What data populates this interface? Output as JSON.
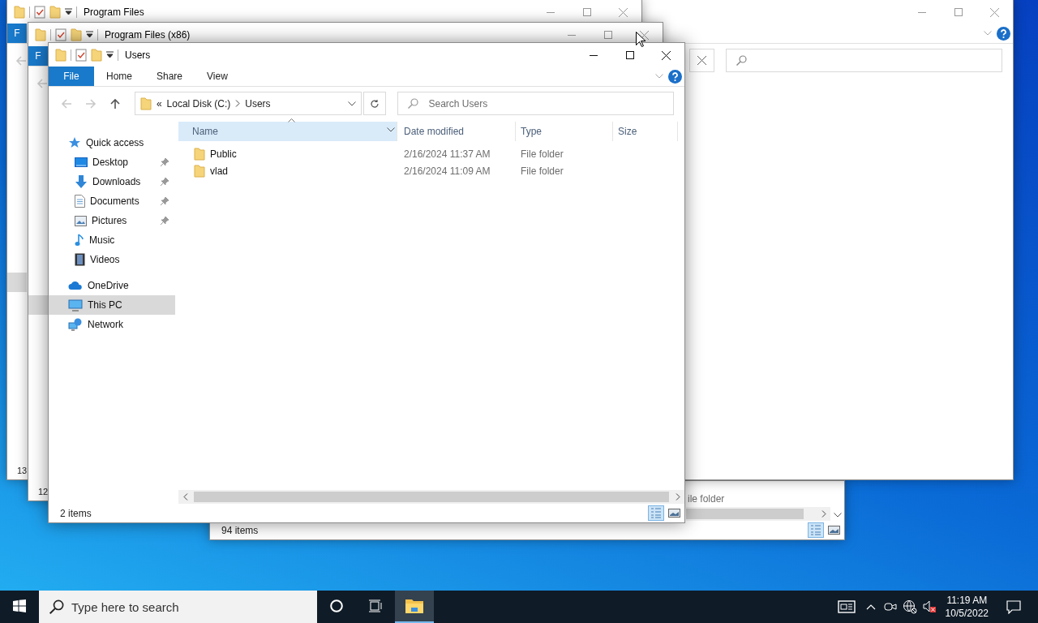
{
  "windows": [
    {
      "kind": "list_fragment",
      "status": "94 items",
      "cells": [
        "ile folder"
      ]
    },
    {
      "kind": "search_fragment"
    },
    {
      "kind": "back",
      "title": "Program Files",
      "file_tab": "F",
      "status": "13"
    },
    {
      "kind": "back",
      "title": "Program Files (x86)",
      "file_tab": "F",
      "status": "12"
    }
  ],
  "explorer": {
    "title": "Users",
    "ribbon": [
      {
        "label": "File",
        "kind": "file"
      },
      {
        "label": "Home",
        "kind": "tab"
      },
      {
        "label": "Share",
        "kind": "tab"
      },
      {
        "label": "View",
        "kind": "tab"
      }
    ],
    "address": {
      "prefix": "«",
      "segments": [
        "Local Disk (C:)",
        "Users"
      ]
    },
    "search": {
      "placeholder": "Search Users"
    },
    "nav": [
      {
        "label": "Quick access",
        "selected": false,
        "children": [
          {
            "label": "Desktop",
            "pinned": true,
            "selected": false
          },
          {
            "label": "Downloads",
            "pinned": true,
            "selected": false
          },
          {
            "label": "Documents",
            "pinned": true,
            "selected": false
          },
          {
            "label": "Pictures",
            "pinned": true,
            "selected": false
          },
          {
            "label": "Music",
            "pinned": false,
            "selected": false
          },
          {
            "label": "Videos",
            "pinned": false,
            "selected": false
          }
        ]
      },
      {
        "label": "OneDrive",
        "selected": false
      },
      {
        "label": "This PC",
        "selected": true
      },
      {
        "label": "Network",
        "selected": false
      }
    ],
    "columns": [
      {
        "label": "Name",
        "sorted": true
      },
      {
        "label": "Date modified",
        "sorted": false
      },
      {
        "label": "Type",
        "sorted": false
      },
      {
        "label": "Size",
        "sorted": false
      }
    ],
    "rows": [
      {
        "name": "Public",
        "date_modified": "2/16/2024 11:37 AM",
        "type": "File folder"
      },
      {
        "name": "vlad",
        "date_modified": "2/16/2024 11:09 AM",
        "type": "File folder"
      }
    ],
    "status": "2 items",
    "views": [
      {
        "selected": true
      },
      {
        "selected": false
      }
    ]
  },
  "taskbar": {
    "search": {
      "placeholder": "Type here to search"
    },
    "apps": [
      {
        "selected": true
      }
    ],
    "muted": true,
    "clock": {
      "time": "11:19 AM",
      "date": "10/5/2022"
    }
  }
}
